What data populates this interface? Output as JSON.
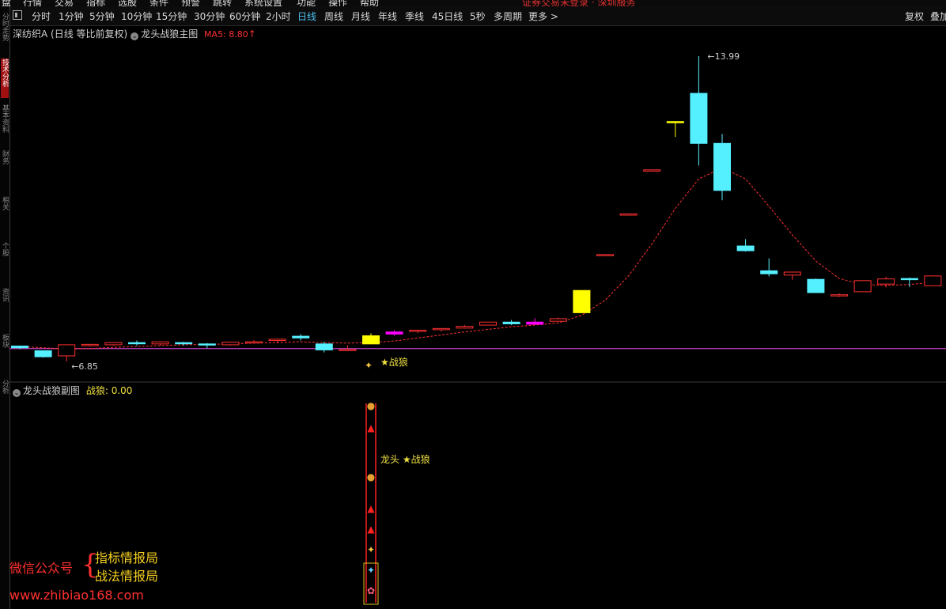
{
  "top_menu": {
    "items": [
      "盘",
      "行情",
      "交易",
      "指标",
      "选股",
      "条件",
      "预警",
      "跳转",
      "系统设置",
      "功能",
      "操作",
      "帮助"
    ],
    "warning": "证券交易未登录 · 深圳服务"
  },
  "toolbar": {
    "periods": [
      "分时",
      "1分钟",
      "5分钟",
      "10分钟",
      "15分钟",
      "30分钟",
      "60分钟",
      "2小时",
      "日线",
      "周线",
      "月线",
      "年线",
      "季线",
      "45日线",
      "5秒",
      "多周期",
      "更多 >"
    ],
    "active_period": "日线",
    "right_items": [
      "复权",
      "叠加"
    ]
  },
  "left_tabs": [
    "分时走势",
    "技术分析",
    "基本资料",
    "财务",
    "相关",
    "个股",
    "资讯",
    "板块",
    "分析"
  ],
  "main_chart": {
    "stock_title": "深纺织A (日线 等比前复权)",
    "indicator_name": "龙头战狼主图",
    "ma_label": "MA5: 8.80",
    "ma_arrow": "↑",
    "high_label": "13.99",
    "low_label": "6.85",
    "signal_label": "★战狼",
    "colors": {
      "up": "#ff3030",
      "down": "#55f0ff",
      "yellow": "#ffff00",
      "magenta": "#ff00ff",
      "baseline": "#c040c0",
      "ma": "#ff3030"
    }
  },
  "sub_chart": {
    "title": "龙头战狼副图",
    "value_label": "战狼: 0.00",
    "signal_text": "龙头 ★战狼"
  },
  "watermark": {
    "line1": "微信公众号",
    "line2a": "指标情报局",
    "line2b": "战法情报局",
    "url": "www.zhibiao168.com"
  },
  "chart_data": {
    "type": "candlestick",
    "price_range": [
      6.85,
      13.99
    ],
    "candles": [
      {
        "o": 7.21,
        "h": 7.22,
        "l": 7.14,
        "c": 7.17
      },
      {
        "o": 7.1,
        "h": 7.1,
        "l": 6.94,
        "c": 6.96
      },
      {
        "o": 6.98,
        "h": 7.24,
        "l": 6.85,
        "c": 7.24
      },
      {
        "o": 7.22,
        "h": 7.26,
        "l": 7.2,
        "c": 7.25
      },
      {
        "o": 7.24,
        "h": 7.3,
        "l": 7.22,
        "c": 7.29
      },
      {
        "o": 7.29,
        "h": 7.34,
        "l": 7.22,
        "c": 7.27
      },
      {
        "o": 7.26,
        "h": 7.32,
        "l": 7.22,
        "c": 7.31
      },
      {
        "o": 7.29,
        "h": 7.31,
        "l": 7.22,
        "c": 7.28
      },
      {
        "o": 7.26,
        "h": 7.28,
        "l": 7.16,
        "c": 7.24
      },
      {
        "o": 7.24,
        "h": 7.31,
        "l": 7.22,
        "c": 7.3
      },
      {
        "o": 7.3,
        "h": 7.35,
        "l": 7.29,
        "c": 7.31
      },
      {
        "o": 7.34,
        "h": 7.38,
        "l": 7.28,
        "c": 7.37
      },
      {
        "o": 7.44,
        "h": 7.49,
        "l": 7.34,
        "c": 7.4
      },
      {
        "o": 7.26,
        "h": 7.31,
        "l": 7.06,
        "c": 7.12
      },
      {
        "o": 7.11,
        "h": 7.23,
        "l": 7.1,
        "c": 7.13
      },
      {
        "o": 7.26,
        "h": 7.51,
        "l": 7.26,
        "c": 7.45
      },
      {
        "o": 7.54,
        "h": 7.58,
        "l": 7.45,
        "c": 7.49
      },
      {
        "o": 7.57,
        "h": 7.59,
        "l": 7.51,
        "c": 7.58
      },
      {
        "o": 7.61,
        "h": 7.62,
        "l": 7.55,
        "c": 7.62
      },
      {
        "o": 7.63,
        "h": 7.7,
        "l": 7.62,
        "c": 7.67
      },
      {
        "o": 7.7,
        "h": 7.77,
        "l": 7.69,
        "c": 7.77
      },
      {
        "o": 7.77,
        "h": 7.82,
        "l": 7.7,
        "c": 7.73
      },
      {
        "o": 7.72,
        "h": 7.86,
        "l": 7.72,
        "c": 7.77
      },
      {
        "o": 7.79,
        "h": 7.88,
        "l": 7.79,
        "c": 7.85
      },
      {
        "o": 7.99,
        "h": 8.51,
        "l": 7.99,
        "c": 8.51
      },
      {
        "o": 9.35,
        "h": 9.35,
        "l": 9.35,
        "c": 9.35
      },
      {
        "o": 10.3,
        "h": 10.3,
        "l": 10.3,
        "c": 10.3
      },
      {
        "o": 11.33,
        "h": 11.33,
        "l": 11.33,
        "c": 11.33
      },
      {
        "o": 12.46,
        "h": 12.46,
        "l": 12.1,
        "c": 12.46
      },
      {
        "o": 13.12,
        "h": 13.99,
        "l": 11.43,
        "c": 11.95
      },
      {
        "o": 11.95,
        "h": 12.17,
        "l": 10.62,
        "c": 10.85
      },
      {
        "o": 9.55,
        "h": 9.71,
        "l": 9.42,
        "c": 9.44
      },
      {
        "o": 8.97,
        "h": 9.26,
        "l": 8.84,
        "c": 8.9
      },
      {
        "o": 8.87,
        "h": 8.94,
        "l": 8.76,
        "c": 8.94
      },
      {
        "o": 8.77,
        "h": 8.79,
        "l": 8.46,
        "c": 8.46
      },
      {
        "o": 8.41,
        "h": 8.44,
        "l": 8.36,
        "c": 8.41
      },
      {
        "o": 8.48,
        "h": 8.74,
        "l": 8.48,
        "c": 8.74
      },
      {
        "o": 8.66,
        "h": 8.83,
        "l": 8.58,
        "c": 8.78
      },
      {
        "o": 8.79,
        "h": 8.81,
        "l": 8.59,
        "c": 8.77
      },
      {
        "o": 8.62,
        "h": 8.86,
        "l": 8.62,
        "c": 8.85
      }
    ],
    "highlight": {
      "9": "",
      "15": "yellow",
      "16": "magenta",
      "22": "magenta",
      "24": "yellow",
      "28": "yellow",
      "29": "cyan"
    },
    "ma5": [
      7.2,
      7.17,
      7.14,
      7.15,
      7.18,
      7.2,
      7.22,
      7.24,
      7.25,
      7.26,
      7.28,
      7.29,
      7.31,
      7.29,
      7.28,
      7.29,
      7.33,
      7.4,
      7.47,
      7.54,
      7.6,
      7.66,
      7.7,
      7.75,
      7.93,
      8.28,
      8.85,
      9.6,
      10.43,
      11.12,
      11.38,
      11.12,
      10.48,
      9.81,
      9.2,
      8.79,
      8.65,
      8.63,
      8.65,
      8.7
    ],
    "baseline": 7.15
  }
}
